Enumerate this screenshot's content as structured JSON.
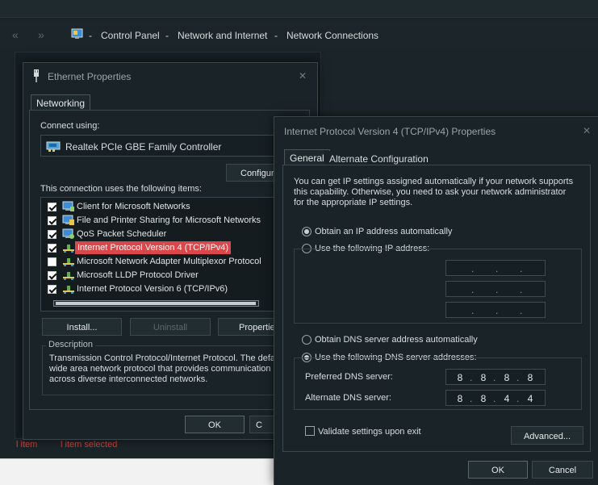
{
  "explorer": {
    "breadcrumb": [
      "Control Panel",
      "Network and Internet",
      "Network Connections"
    ],
    "breadcrumb_sep": "-",
    "status_count": "l item",
    "status_selected": "l item selected"
  },
  "eth": {
    "title": "Ethernet Properties",
    "tab": "Networking",
    "connect_using_label": "Connect using:",
    "adapter": "Realtek PCIe GBE Family Controller",
    "configure_btn": "Configur",
    "items_label": "This connection uses the following items:",
    "items": [
      {
        "label": "Client for Microsoft Networks",
        "checked": true,
        "icon": "client-icon",
        "selected": false
      },
      {
        "label": "File and Printer Sharing for Microsoft Networks",
        "checked": true,
        "icon": "sharing-icon",
        "selected": false
      },
      {
        "label": "QoS Packet Scheduler",
        "checked": true,
        "icon": "scheduler-icon",
        "selected": false
      },
      {
        "label": "Internet Protocol Version 4 (TCP/IPv4)",
        "checked": true,
        "icon": "protocol-icon",
        "selected": true
      },
      {
        "label": "Microsoft Network Adapter Multiplexor Protocol",
        "checked": false,
        "icon": "protocol-icon",
        "selected": false
      },
      {
        "label": "Microsoft LLDP Protocol Driver",
        "checked": true,
        "icon": "protocol-icon",
        "selected": false
      },
      {
        "label": "Internet Protocol Version 6 (TCP/IPv6)",
        "checked": true,
        "icon": "protocol-icon",
        "selected": false
      }
    ],
    "install_btn": "Install...",
    "uninstall_btn": "Uninstall",
    "properties_btn": "Propertie",
    "description_label": "Description",
    "description_lines": [
      "Transmission Control Protocol/Internet Protocol. The defau",
      "wide area network protocol that provides communication",
      "across diverse interconnected networks."
    ],
    "ok_btn": "OK",
    "cancel_btn": "C"
  },
  "ipv4": {
    "title": "Internet Protocol Version 4 (TCP/IPv4) Properties",
    "tab_general": "General",
    "tab_alternate": "Alternate Configuration",
    "intro_lines": [
      "You can get IP settings assigned automatically if your network supports",
      "this capability. Otherwise, you need to ask your network administrator",
      "for the appropriate IP settings."
    ],
    "obtain_ip_auto": "Obtain an IP address automatically",
    "use_following_ip": "Use the following IP address:",
    "ip_mode": "auto",
    "obtain_dns_auto": "Obtain DNS server address automatically",
    "use_following_dns": "Use the following DNS server addresses:",
    "dns_mode": "manual",
    "preferred_dns_label": "Preferred DNS server:",
    "preferred_dns": [
      "8",
      "8",
      "8",
      "8"
    ],
    "alternate_dns_label": "Alternate DNS server:",
    "alternate_dns": [
      "8",
      "8",
      "4",
      "4"
    ],
    "validate_label": "Validate settings upon exit",
    "validate_checked": false,
    "advanced_btn": "Advanced...",
    "ok_btn": "OK",
    "cancel_btn": "Cancel"
  },
  "colors": {
    "selection": "#d9474b",
    "status_text": "#d24038",
    "window_bg": "#1a2428"
  }
}
